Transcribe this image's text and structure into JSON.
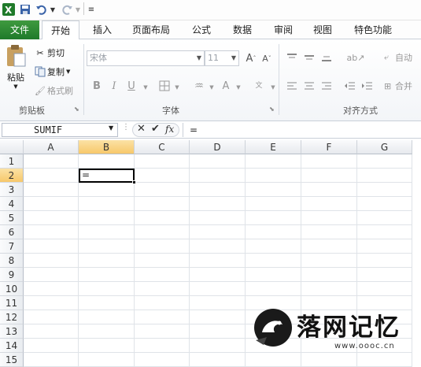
{
  "qat": {
    "save_icon": "save-icon",
    "undo_icon": "undo-icon",
    "redo_icon": "redo-icon"
  },
  "tabs": {
    "file": "文件",
    "home": "开始",
    "insert": "插入",
    "page_layout": "页面布局",
    "formulas": "公式",
    "data": "数据",
    "review": "审阅",
    "view": "视图",
    "special": "特色功能"
  },
  "ribbon": {
    "clipboard": {
      "paste": "粘贴",
      "cut": "剪切",
      "copy": "复制",
      "format_painter": "格式刷",
      "label": "剪贴板"
    },
    "font": {
      "font_name": "宋体",
      "font_size": "11",
      "grow": "A",
      "shrink": "A",
      "bold": "B",
      "italic": "I",
      "underline": "U",
      "label": "字体"
    },
    "alignment": {
      "wrap": "自动",
      "merge": "合并",
      "label": "对齐方式"
    }
  },
  "formula_bar": {
    "name_box": "SUMIF",
    "fx": "fx",
    "content": "="
  },
  "grid": {
    "columns": [
      "A",
      "B",
      "C",
      "D",
      "E",
      "F",
      "G"
    ],
    "rows": [
      "1",
      "2",
      "3",
      "4",
      "5",
      "6",
      "7",
      "8",
      "9",
      "10",
      "11",
      "12",
      "13",
      "14",
      "15"
    ],
    "active_cell_value": "="
  },
  "watermark": {
    "brand": "落网记忆",
    "url": "www.oooc.cn"
  },
  "colors": {
    "file_tab": "#217346",
    "selection_header": "#f7c86a",
    "active_border": "#000000"
  }
}
